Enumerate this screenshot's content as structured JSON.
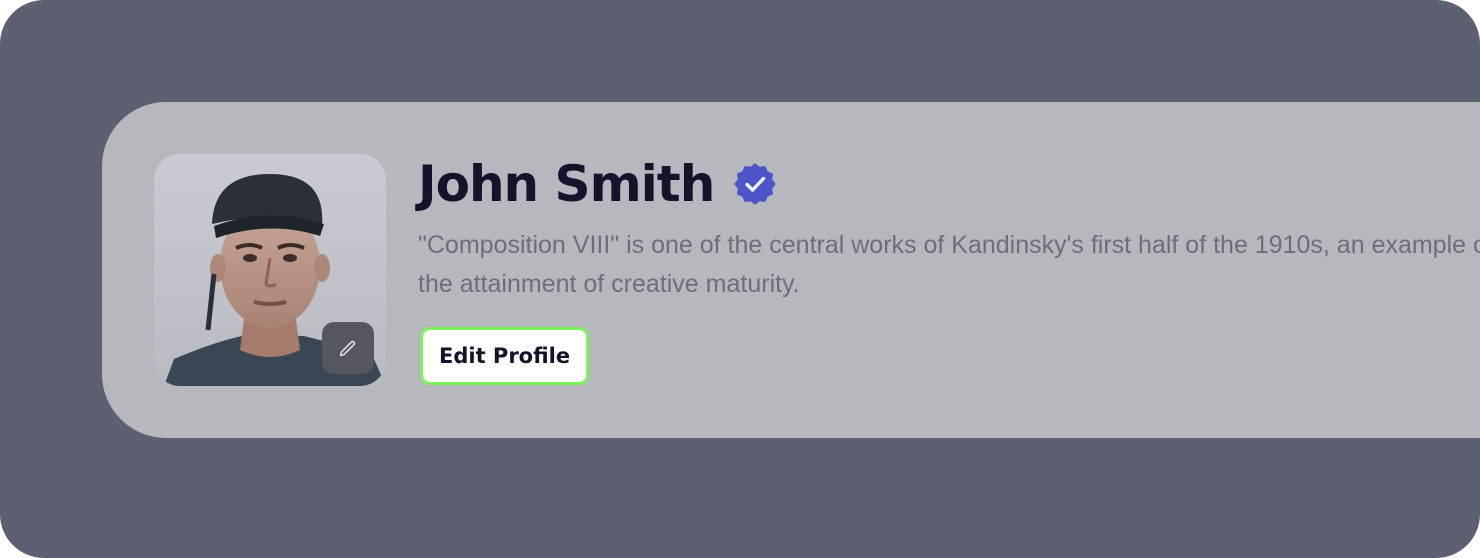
{
  "profile": {
    "name": "John Smith",
    "bio": "\"Composition VIII\" is one of the central works of Kandinsky's first half of the 1910s, an example of the attainment of creative maturity.",
    "verified": true,
    "edit_button_label": "Edit Profile"
  },
  "icons": {
    "verified": "verified-badge-icon",
    "avatar_edit": "pencil-icon"
  },
  "colors": {
    "background": "#5d6070",
    "card": "#b7b8bd",
    "name_text": "#14132b",
    "bio_text": "#6d6e78",
    "verified_badge": "#4b55c8",
    "button_border": "#7df15a",
    "button_background": "#ffffff"
  }
}
